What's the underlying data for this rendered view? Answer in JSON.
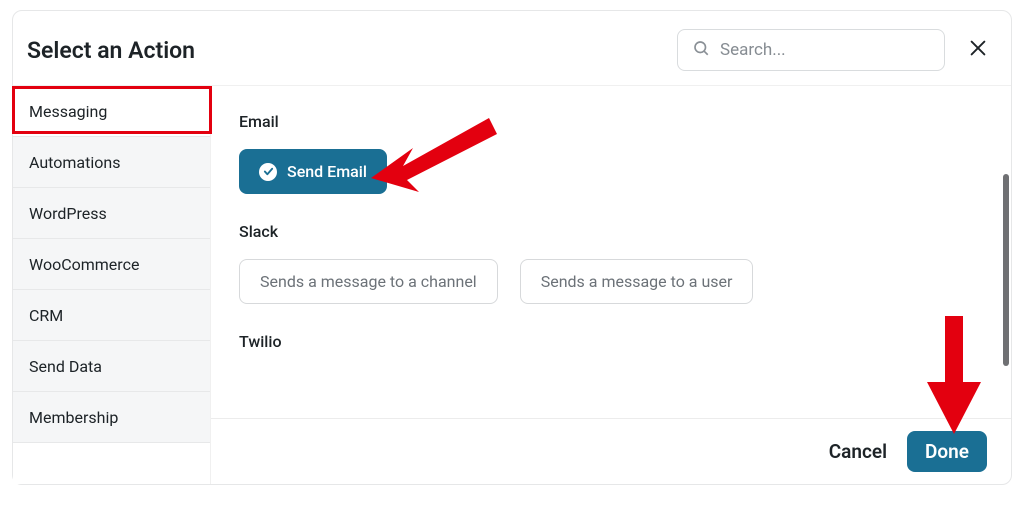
{
  "header": {
    "title": "Select an Action",
    "search_placeholder": "Search..."
  },
  "sidebar": {
    "items": [
      {
        "label": "Messaging",
        "active": true
      },
      {
        "label": "Automations"
      },
      {
        "label": "WordPress"
      },
      {
        "label": "WooCommerce"
      },
      {
        "label": "CRM"
      },
      {
        "label": "Send Data"
      },
      {
        "label": "Membership"
      }
    ]
  },
  "sections": [
    {
      "title": "Email",
      "actions": [
        {
          "label": "Send Email",
          "selected": true
        }
      ]
    },
    {
      "title": "Slack",
      "actions": [
        {
          "label": "Sends a message to a channel"
        },
        {
          "label": "Sends a message to a user"
        }
      ]
    },
    {
      "title": "Twilio",
      "actions": []
    }
  ],
  "footer": {
    "cancel": "Cancel",
    "done": "Done"
  },
  "colors": {
    "primary": "#1a6f94",
    "highlight": "#e3000f",
    "arrow": "#e3000f"
  }
}
